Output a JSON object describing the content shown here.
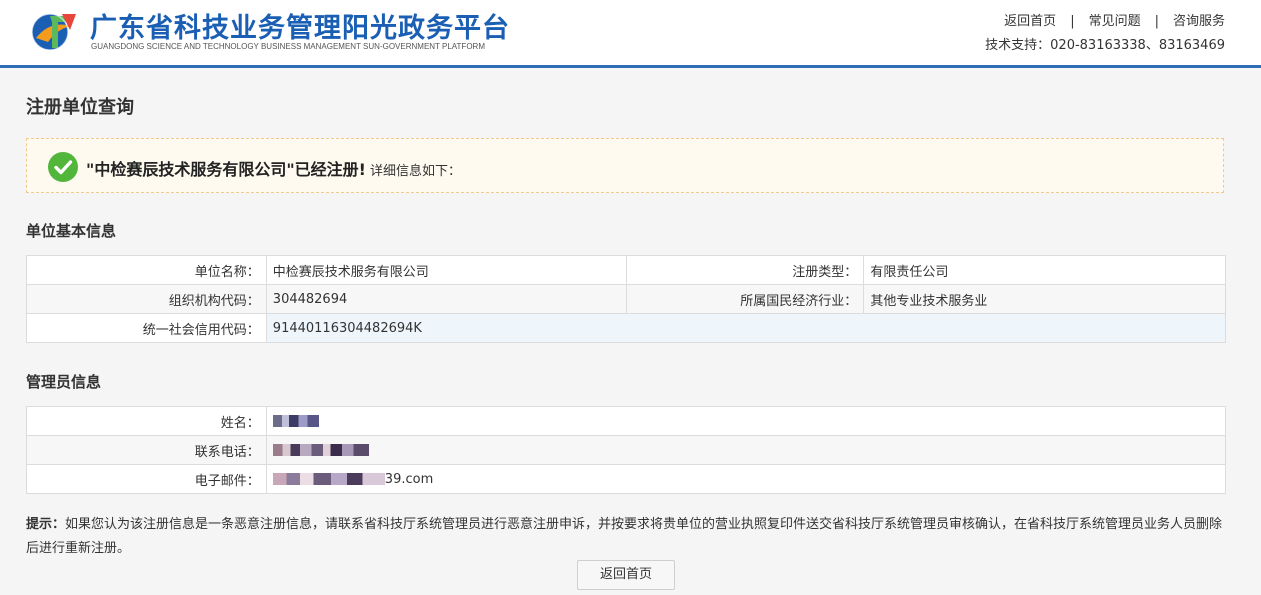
{
  "header": {
    "title": "广东省科技业务管理阳光政务平台",
    "subtitle": "GUANGDONG SCIENCE AND TECHNOLOGY BUSINESS MANAGEMENT SUN-GOVERNMENT PLATFORM",
    "nav": [
      "返回首页",
      "常见问题",
      "咨询服务"
    ],
    "nav_separator": "|",
    "support": "技术支持：020-83163338、83163469",
    "logo_icon": "gd-logo-icon"
  },
  "page": {
    "title": "注册单位查询"
  },
  "notice": {
    "icon": "check-circle-icon",
    "strong": "\"中检赛辰技术服务有限公司\"已经注册!",
    "detail": "详细信息如下："
  },
  "unit_info": {
    "title": "单位基本信息",
    "rows": [
      {
        "label1": "单位名称：",
        "value1": "中检赛辰技术服务有限公司",
        "label2": "注册类型：",
        "value2": "有限责任公司"
      },
      {
        "label1": "组织机构代码：",
        "value1": "304482694",
        "label2": "所属国民经济行业：",
        "value2": "其他专业技术服务业"
      },
      {
        "label1": "统一社会信用代码：",
        "value1": "91440116304482694K"
      }
    ]
  },
  "admin_info": {
    "title": "管理员信息",
    "rows": [
      {
        "label": "姓名："
      },
      {
        "label": "联系电话："
      },
      {
        "label": "电子邮件：",
        "value_suffix": "39.com"
      }
    ]
  },
  "hint": {
    "prefix": "提示：",
    "text": "如果您认为该注册信息是一条恶意注册信息，请联系省科技厅系统管理员进行恶意注册申诉，并按要求将贵单位的营业执照复印件送交省科技厅系统管理员审核确认，在省科技厅系统管理员业务人员删除后进行重新注册。"
  },
  "actions": {
    "back_label": "返回首页"
  },
  "colors": {
    "brand": "#1a5fb4",
    "header_line": "#2f6db4",
    "success": "#52b63a",
    "notice_bg": "#fffaf0",
    "notice_border": "#f2c98b"
  }
}
